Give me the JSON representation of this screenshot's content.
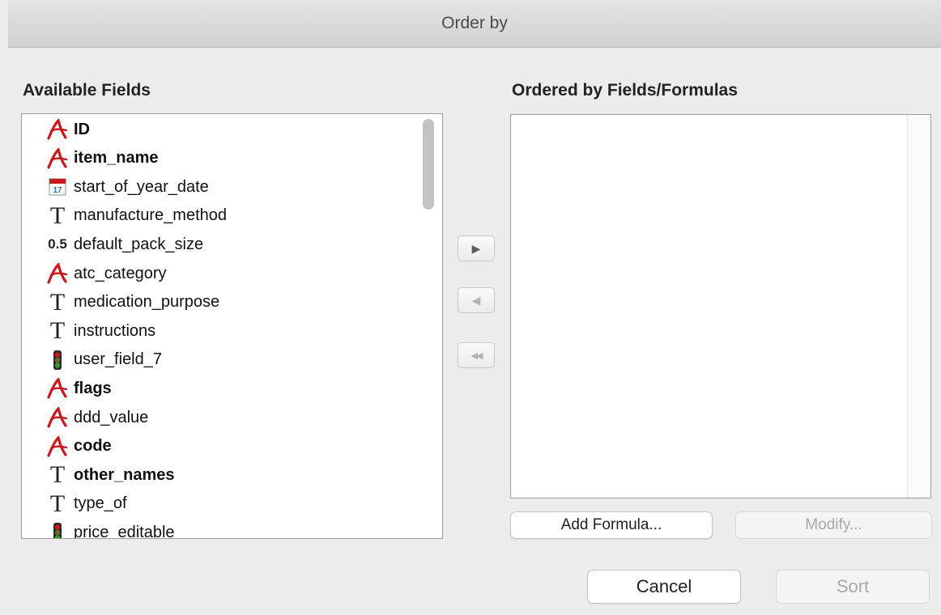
{
  "window": {
    "title": "Order by"
  },
  "available_fields": {
    "label": "Available Fields",
    "items": [
      {
        "name": "ID",
        "icon": "alpha-icon",
        "bold": true
      },
      {
        "name": "item_name",
        "icon": "alpha-icon",
        "bold": true
      },
      {
        "name": "start_of_year_date",
        "icon": "calendar-icon",
        "calendar_day": "17",
        "bold": false
      },
      {
        "name": "manufacture_method",
        "icon": "text-icon",
        "glyph": "T",
        "bold": false
      },
      {
        "name": "default_pack_size",
        "icon": "real-number-icon",
        "glyph": "0.5",
        "bold": false
      },
      {
        "name": "atc_category",
        "icon": "alpha-icon",
        "bold": false
      },
      {
        "name": "medication_purpose",
        "icon": "text-icon",
        "glyph": "T",
        "bold": false
      },
      {
        "name": "instructions",
        "icon": "text-icon",
        "glyph": "T",
        "bold": false
      },
      {
        "name": "user_field_7",
        "icon": "boolean-icon",
        "bold": false
      },
      {
        "name": "flags",
        "icon": "alpha-icon",
        "bold": true
      },
      {
        "name": "ddd_value",
        "icon": "alpha-icon",
        "bold": false
      },
      {
        "name": "code",
        "icon": "alpha-icon",
        "bold": true
      },
      {
        "name": "other_names",
        "icon": "text-icon",
        "glyph": "T",
        "bold": true
      },
      {
        "name": "type_of",
        "icon": "text-icon",
        "glyph": "T",
        "bold": false
      },
      {
        "name": "price_editable",
        "icon": "boolean-icon",
        "bold": false
      }
    ]
  },
  "ordered_fields": {
    "label": "Ordered by Fields/Formulas",
    "items": []
  },
  "move_buttons": {
    "add": {
      "glyph": "▶",
      "enabled": true
    },
    "remove": {
      "glyph": "◀",
      "enabled": false
    },
    "remove_all": {
      "glyph": "◀◀",
      "enabled": false
    }
  },
  "buttons": {
    "add_formula": "Add Formula...",
    "modify": "Modify...",
    "cancel": "Cancel",
    "sort": "Sort"
  },
  "colors": {
    "alpha_icon": "#c8191e",
    "boolean_green": "#3b9a2a",
    "boolean_red": "#c8191e",
    "calendar_blue": "#2f6fb0"
  }
}
